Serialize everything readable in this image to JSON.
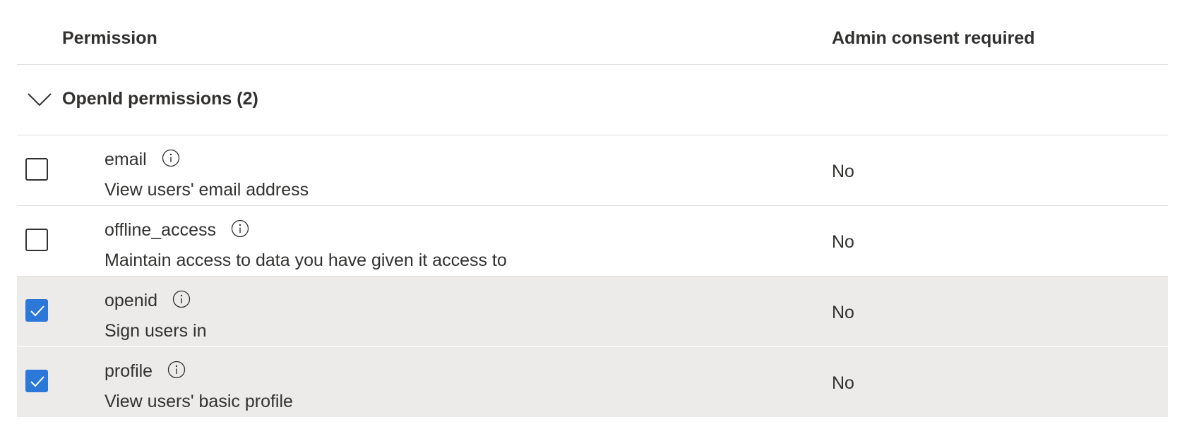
{
  "header": {
    "permission_label": "Permission",
    "admin_consent_label": "Admin consent required"
  },
  "group": {
    "label": "OpenId permissions (2)",
    "expanded": true,
    "chevron_icon": "chevron-down-icon"
  },
  "rows": [
    {
      "name": "email",
      "description": "View users' email address",
      "admin_consent": "No",
      "checked": false
    },
    {
      "name": "offline_access",
      "description": "Maintain access to data you have given it access to",
      "admin_consent": "No",
      "checked": false
    },
    {
      "name": "openid",
      "description": "Sign users in",
      "admin_consent": "No",
      "checked": true
    },
    {
      "name": "profile",
      "description": "View users' basic profile",
      "admin_consent": "No",
      "checked": true
    }
  ],
  "colors": {
    "checkbox_checked": "#2b78d9",
    "row_selected_bg": "#edebe9",
    "divider": "#e1dfdd",
    "text": "#323130"
  }
}
